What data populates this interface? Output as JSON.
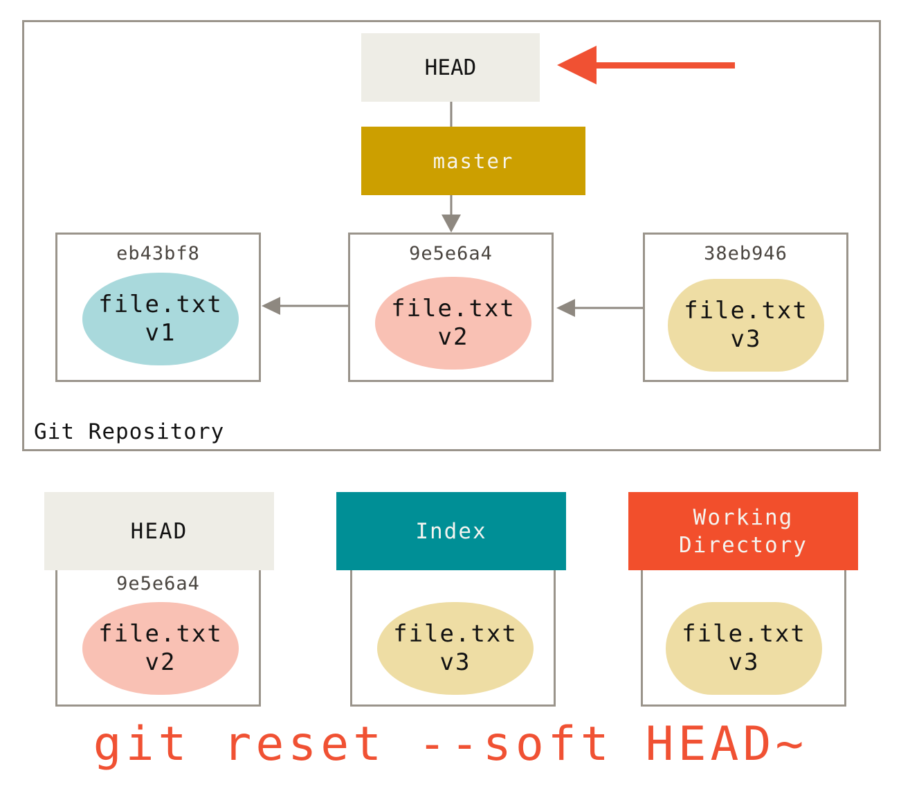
{
  "repository": {
    "label": "Git Repository",
    "head_label": "HEAD",
    "branch_label": "master",
    "commits": [
      {
        "sha": "eb43bf8",
        "file": "file.txt",
        "version": "v1",
        "color": "#a9d9dc"
      },
      {
        "sha": "9e5e6a4",
        "file": "file.txt",
        "version": "v2",
        "color": "#f9c1b4"
      },
      {
        "sha": "38eb946",
        "file": "file.txt",
        "version": "v3",
        "color": "#eedda4"
      }
    ]
  },
  "areas": [
    {
      "title": "HEAD",
      "sha": "9e5e6a4",
      "file": "file.txt",
      "version": "v2",
      "header_color": "#eeede6",
      "blob_color": "#f9c1b4"
    },
    {
      "title": "Index",
      "sha": "",
      "file": "file.txt",
      "version": "v3",
      "header_color": "#008f96",
      "blob_color": "#eedda4"
    },
    {
      "title_line1": "Working",
      "title_line2": "Directory",
      "sha": "",
      "file": "file.txt",
      "version": "v3",
      "header_color": "#f24f2c",
      "blob_color": "#eedda4"
    }
  ],
  "command": "git reset --soft HEAD~",
  "colors": {
    "accent_arrow": "#f05133",
    "connector": "#8e8880",
    "branch": "#cc9f00",
    "border": "#9a948b"
  }
}
